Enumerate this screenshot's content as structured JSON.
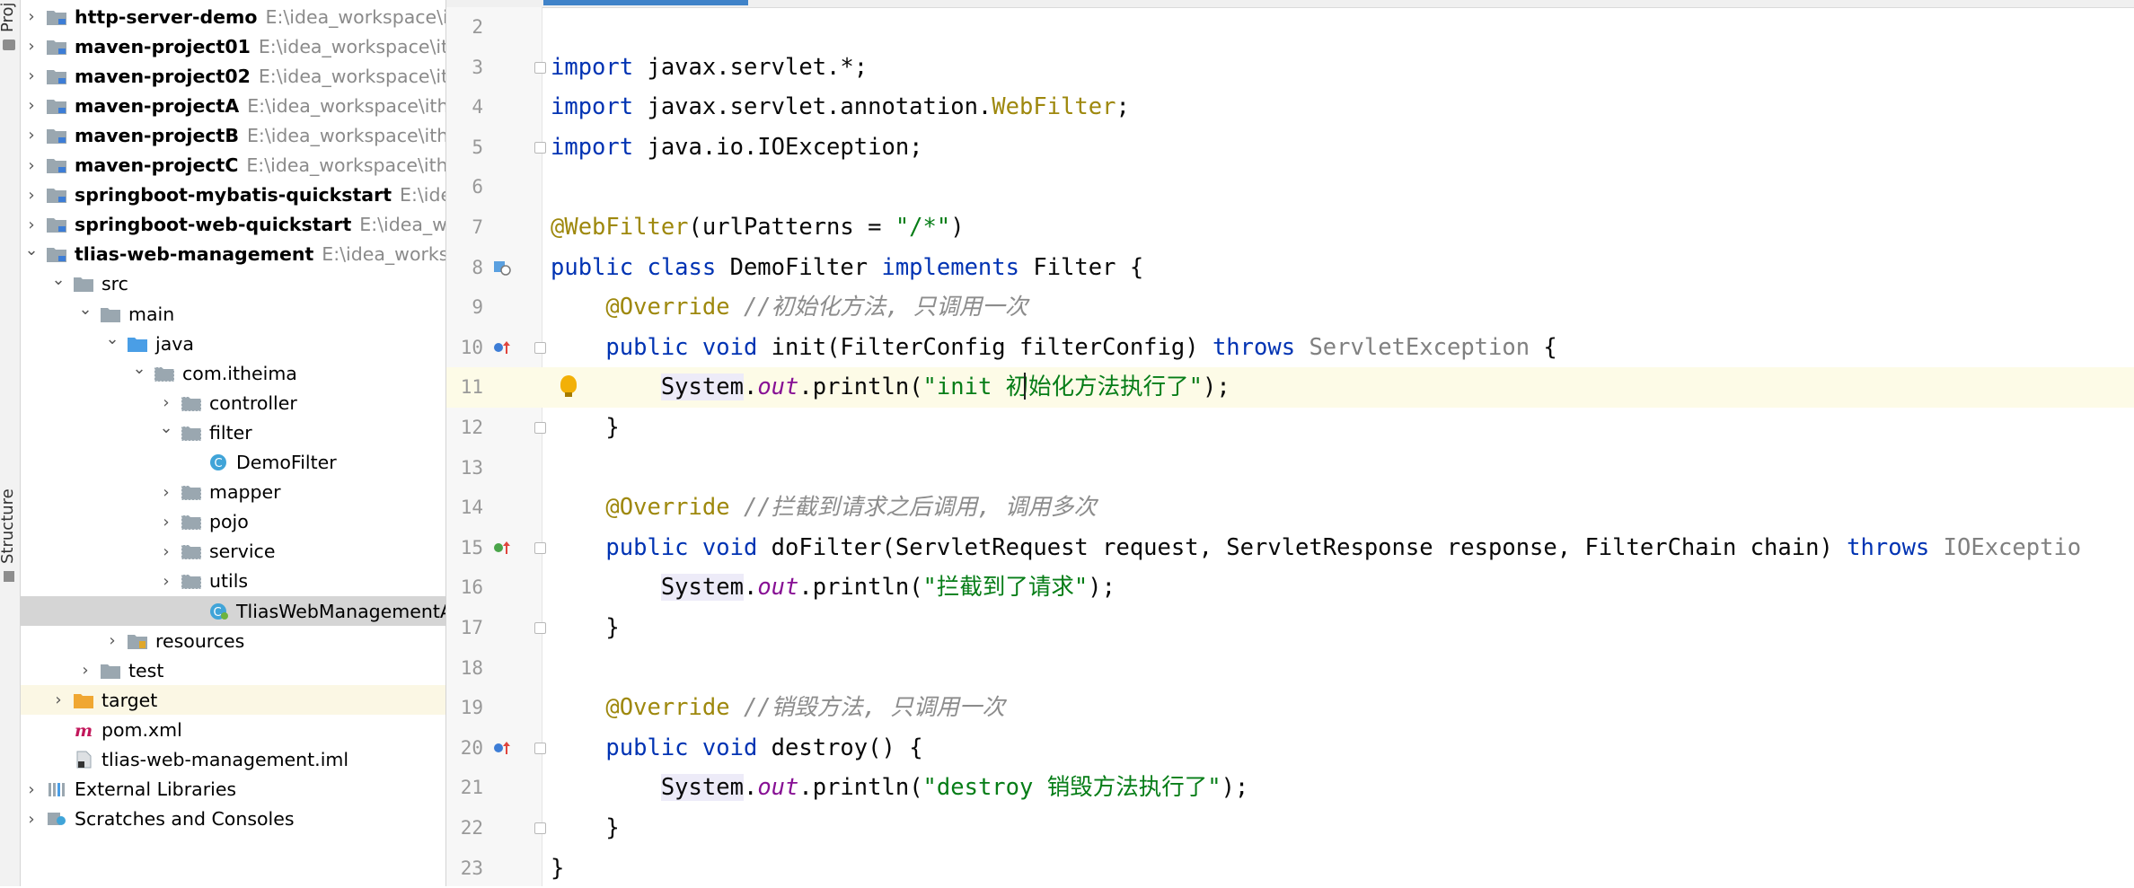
{
  "toolstrip": {
    "top_label": "Proj",
    "bottom_label": "Structure"
  },
  "tree": [
    {
      "name": "http-server-demo",
      "path": "E:\\idea_workspace\\itheima",
      "bold": true,
      "indent": 0,
      "arrow": "right",
      "icon": "module-folder-icon"
    },
    {
      "name": "maven-project01",
      "path": "E:\\idea_workspace\\itheima",
      "bold": true,
      "indent": 0,
      "arrow": "right",
      "icon": "module-folder-icon"
    },
    {
      "name": "maven-project02",
      "path": "E:\\idea_workspace\\itheima",
      "bold": true,
      "indent": 0,
      "arrow": "right",
      "icon": "module-folder-icon"
    },
    {
      "name": "maven-projectA",
      "path": "E:\\idea_workspace\\itheima",
      "bold": true,
      "indent": 0,
      "arrow": "right",
      "icon": "module-folder-icon"
    },
    {
      "name": "maven-projectB",
      "path": "E:\\idea_workspace\\itheima",
      "bold": true,
      "indent": 0,
      "arrow": "right",
      "icon": "module-folder-icon"
    },
    {
      "name": "maven-projectC",
      "path": "E:\\idea_workspace\\itheima",
      "bold": true,
      "indent": 0,
      "arrow": "right",
      "icon": "module-folder-icon"
    },
    {
      "name": "springboot-mybatis-quickstart",
      "path": "E:\\idea_w",
      "bold": true,
      "indent": 0,
      "arrow": "right",
      "icon": "module-folder-icon"
    },
    {
      "name": "springboot-web-quickstart",
      "path": "E:\\idea_work",
      "bold": true,
      "indent": 0,
      "arrow": "right",
      "icon": "module-folder-icon"
    },
    {
      "name": "tlias-web-management",
      "path": "E:\\idea_workspace",
      "bold": true,
      "indent": 0,
      "arrow": "down",
      "icon": "module-folder-icon"
    },
    {
      "name": "src",
      "path": "",
      "bold": false,
      "indent": 1,
      "arrow": "down",
      "icon": "folder-icon"
    },
    {
      "name": "main",
      "path": "",
      "bold": false,
      "indent": 2,
      "arrow": "down",
      "icon": "folder-icon"
    },
    {
      "name": "java",
      "path": "",
      "bold": false,
      "indent": 3,
      "arrow": "down",
      "icon": "source-folder-icon"
    },
    {
      "name": "com.itheima",
      "path": "",
      "bold": false,
      "indent": 4,
      "arrow": "down",
      "icon": "package-icon"
    },
    {
      "name": "controller",
      "path": "",
      "bold": false,
      "indent": 5,
      "arrow": "right",
      "icon": "package-icon"
    },
    {
      "name": "filter",
      "path": "",
      "bold": false,
      "indent": 5,
      "arrow": "down",
      "icon": "package-icon"
    },
    {
      "name": "DemoFilter",
      "path": "",
      "bold": false,
      "indent": 6,
      "arrow": "none",
      "icon": "class-icon"
    },
    {
      "name": "mapper",
      "path": "",
      "bold": false,
      "indent": 5,
      "arrow": "right",
      "icon": "package-icon"
    },
    {
      "name": "pojo",
      "path": "",
      "bold": false,
      "indent": 5,
      "arrow": "right",
      "icon": "package-icon"
    },
    {
      "name": "service",
      "path": "",
      "bold": false,
      "indent": 5,
      "arrow": "right",
      "icon": "package-icon"
    },
    {
      "name": "utils",
      "path": "",
      "bold": false,
      "indent": 5,
      "arrow": "right",
      "icon": "package-icon"
    },
    {
      "name": "TliasWebManagementApplication",
      "path": "",
      "bold": false,
      "indent": 6,
      "arrow": "none",
      "icon": "springboot-class-icon",
      "highlight": "selected"
    },
    {
      "name": "resources",
      "path": "",
      "bold": false,
      "indent": 3,
      "arrow": "right",
      "icon": "resources-folder-icon"
    },
    {
      "name": "test",
      "path": "",
      "bold": false,
      "indent": 2,
      "arrow": "right",
      "icon": "folder-icon"
    },
    {
      "name": "target",
      "path": "",
      "bold": false,
      "indent": 1,
      "arrow": "right",
      "icon": "excluded-folder-icon",
      "highlight": "target"
    },
    {
      "name": "pom.xml",
      "path": "",
      "bold": false,
      "indent": 1,
      "arrow": "none",
      "icon": "maven-icon"
    },
    {
      "name": "tlias-web-management.iml",
      "path": "",
      "bold": false,
      "indent": 1,
      "arrow": "none",
      "icon": "iml-file-icon"
    },
    {
      "name": "External Libraries",
      "path": "",
      "bold": false,
      "indent": 0,
      "arrow": "right",
      "icon": "libraries-icon"
    },
    {
      "name": "Scratches and Consoles",
      "path": "",
      "bold": false,
      "indent": 0,
      "arrow": "right",
      "icon": "scratches-icon"
    }
  ],
  "editor": {
    "lines": [
      {
        "num": "2",
        "tokens": []
      },
      {
        "num": "3",
        "fold": true,
        "tokens": [
          {
            "c": "kw",
            "t": "import"
          },
          {
            "c": "",
            "t": " javax.servlet.*;"
          }
        ]
      },
      {
        "num": "4",
        "tokens": [
          {
            "c": "kw",
            "t": "import"
          },
          {
            "c": "",
            "t": " javax.servlet.annotation."
          },
          {
            "c": "ann",
            "t": "WebFilter"
          },
          {
            "c": "",
            "t": ";"
          }
        ]
      },
      {
        "num": "5",
        "fold": true,
        "tokens": [
          {
            "c": "kw",
            "t": "import"
          },
          {
            "c": "",
            "t": " java.io.IOException;"
          }
        ]
      },
      {
        "num": "6",
        "tokens": []
      },
      {
        "num": "7",
        "tokens": [
          {
            "c": "ann",
            "t": "@WebFilter"
          },
          {
            "c": "",
            "t": "(urlPatterns = "
          },
          {
            "c": "str",
            "t": "\"/*\""
          },
          {
            "c": "",
            "t": ")"
          }
        ]
      },
      {
        "num": "8",
        "gutter": "implements-icon",
        "tokens": [
          {
            "c": "kw",
            "t": "public class"
          },
          {
            "c": "",
            "t": " DemoFilter "
          },
          {
            "c": "kw",
            "t": "implements"
          },
          {
            "c": "",
            "t": " Filter {"
          }
        ]
      },
      {
        "num": "9",
        "tokens": [
          {
            "c": "",
            "t": "    "
          },
          {
            "c": "ann",
            "t": "@Override"
          },
          {
            "c": "",
            "t": " "
          },
          {
            "c": "cmt",
            "t": "//初始化方法, 只调用一次"
          }
        ]
      },
      {
        "num": "10",
        "gutter": "override-up-icon",
        "fold": true,
        "tokens": [
          {
            "c": "",
            "t": "    "
          },
          {
            "c": "kw",
            "t": "public void"
          },
          {
            "c": "",
            "t": " init(FilterConfig filterConfig) "
          },
          {
            "c": "kw",
            "t": "throws"
          },
          {
            "c": "",
            "t": " "
          },
          {
            "c": "typeref",
            "t": "ServletException"
          },
          {
            "c": "",
            "t": " {"
          }
        ]
      },
      {
        "num": "11",
        "current": true,
        "bulb": true,
        "caret": true,
        "tokens": [
          {
            "c": "",
            "t": "        "
          },
          {
            "c": "sysbg",
            "t": "System"
          },
          {
            "c": "",
            "t": "."
          },
          {
            "c": "fld",
            "t": "out"
          },
          {
            "c": "",
            "t": ".println("
          },
          {
            "c": "str",
            "t": "\"init 初始化方法执行了\""
          },
          {
            "c": "",
            "t": ");"
          }
        ]
      },
      {
        "num": "12",
        "fold": true,
        "tokens": [
          {
            "c": "",
            "t": "    }"
          }
        ]
      },
      {
        "num": "13",
        "tokens": []
      },
      {
        "num": "14",
        "tokens": [
          {
            "c": "",
            "t": "    "
          },
          {
            "c": "ann",
            "t": "@Override"
          },
          {
            "c": "",
            "t": " "
          },
          {
            "c": "cmt",
            "t": "//拦截到请求之后调用, 调用多次"
          }
        ]
      },
      {
        "num": "15",
        "gutter": "override-green-icon",
        "fold": true,
        "tokens": [
          {
            "c": "",
            "t": "    "
          },
          {
            "c": "kw",
            "t": "public void"
          },
          {
            "c": "",
            "t": " doFilter(ServletRequest request, ServletResponse response, FilterChain chain) "
          },
          {
            "c": "kw",
            "t": "throws"
          },
          {
            "c": "",
            "t": " "
          },
          {
            "c": "typeref",
            "t": "IOExceptio"
          }
        ]
      },
      {
        "num": "16",
        "tokens": [
          {
            "c": "",
            "t": "        "
          },
          {
            "c": "sysbg",
            "t": "System"
          },
          {
            "c": "",
            "t": "."
          },
          {
            "c": "fld",
            "t": "out"
          },
          {
            "c": "",
            "t": ".println("
          },
          {
            "c": "str",
            "t": "\"拦截到了请求\""
          },
          {
            "c": "",
            "t": ");"
          }
        ]
      },
      {
        "num": "17",
        "fold": true,
        "tokens": [
          {
            "c": "",
            "t": "    }"
          }
        ]
      },
      {
        "num": "18",
        "tokens": []
      },
      {
        "num": "19",
        "tokens": [
          {
            "c": "",
            "t": "    "
          },
          {
            "c": "ann",
            "t": "@Override"
          },
          {
            "c": "",
            "t": " "
          },
          {
            "c": "cmt",
            "t": "//销毁方法, 只调用一次"
          }
        ]
      },
      {
        "num": "20",
        "gutter": "override-up-icon",
        "fold": true,
        "tokens": [
          {
            "c": "",
            "t": "    "
          },
          {
            "c": "kw",
            "t": "public void"
          },
          {
            "c": "",
            "t": " destroy() {"
          }
        ]
      },
      {
        "num": "21",
        "tokens": [
          {
            "c": "",
            "t": "        "
          },
          {
            "c": "sysbg",
            "t": "System"
          },
          {
            "c": "",
            "t": "."
          },
          {
            "c": "fld",
            "t": "out"
          },
          {
            "c": "",
            "t": ".println("
          },
          {
            "c": "str",
            "t": "\"destroy 销毁方法执行了\""
          },
          {
            "c": "",
            "t": ");"
          }
        ]
      },
      {
        "num": "22",
        "fold": true,
        "tokens": [
          {
            "c": "",
            "t": "    }"
          }
        ]
      },
      {
        "num": "23",
        "tokens": [
          {
            "c": "",
            "t": "}"
          }
        ]
      }
    ]
  },
  "colors": {
    "keyword": "#0033b3",
    "annotation": "#9e880d",
    "string": "#067d17",
    "comment": "#8c8c8c",
    "field": "#871094",
    "selection": "#d5d5d5",
    "current_line": "#fdfbe7",
    "tab_indicator": "#4083c9"
  }
}
